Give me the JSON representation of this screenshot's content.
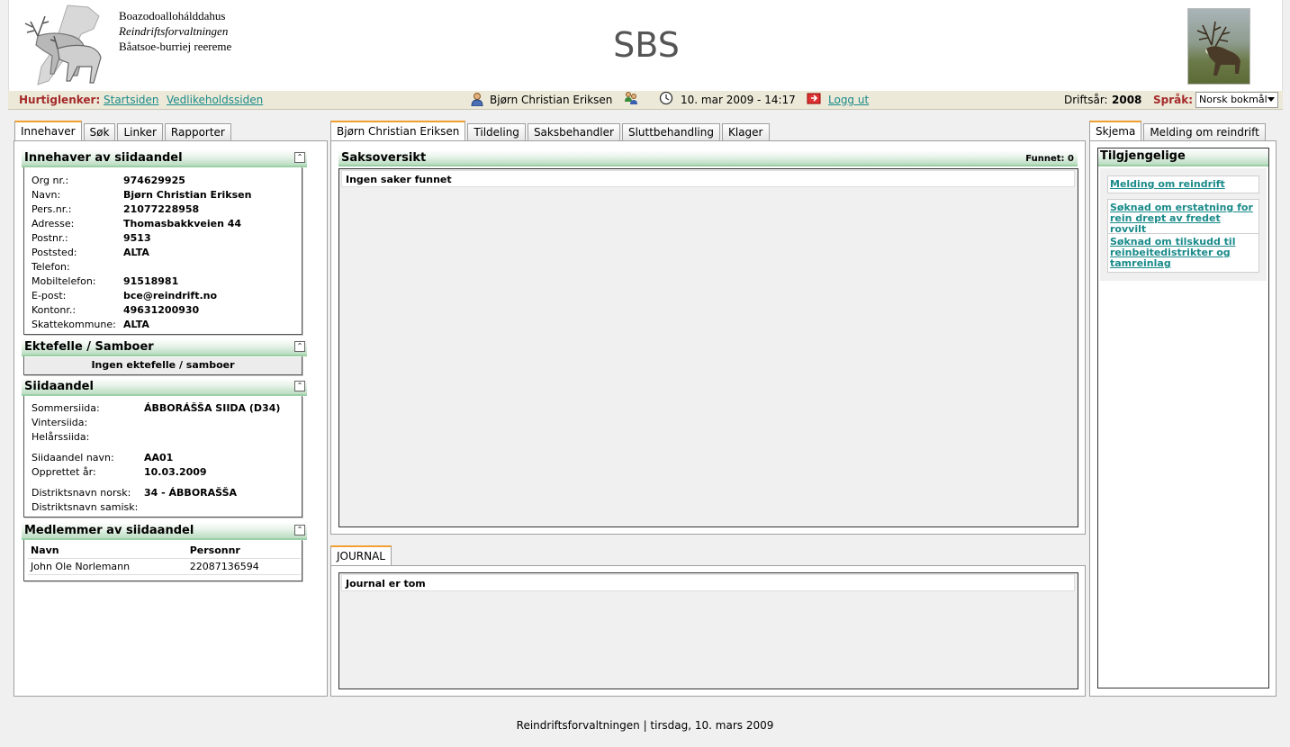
{
  "header": {
    "org_lines": [
      "Boazodoallohálddahus",
      "Reindriftsforvaltningen",
      "Båatsoe-burriej reereme"
    ],
    "app_title": "SBS"
  },
  "quickbar": {
    "label": "Hurtiglenker:",
    "links": [
      "Startsiden",
      "Vedlikeholdssiden"
    ],
    "user_name": "Bjørn Christian Eriksen",
    "datetime": "10. mar 2009 - 14:17",
    "logout": "Logg ut",
    "driftsar_label": "Driftsår:",
    "driftsar_value": "2008",
    "language_label": "Språk:",
    "language_value": "Norsk bokmål"
  },
  "left_tabs": [
    "Innehaver",
    "Søk",
    "Linker",
    "Rapporter"
  ],
  "owner": {
    "title": "Innehaver av siidaandel",
    "fields": [
      {
        "label": "Org nr.:",
        "value": "974629925"
      },
      {
        "label": "Navn:",
        "value": "Bjørn Christian Eriksen"
      },
      {
        "label": "Pers.nr.:",
        "value": "21077228958"
      },
      {
        "label": "Adresse:",
        "value": "Thomasbakkveien 44"
      },
      {
        "label": "Postnr.:",
        "value": "9513"
      },
      {
        "label": "Poststed:",
        "value": "ALTA"
      },
      {
        "label": "Telefon:",
        "value": ""
      },
      {
        "label": "Mobiltelefon:",
        "value": "91518981"
      },
      {
        "label": "E-post:",
        "value": "bce@reindrift.no"
      },
      {
        "label": "Kontonr.:",
        "value": "49631200930"
      },
      {
        "label": "Skattekommune:",
        "value": "ALTA"
      }
    ]
  },
  "spouse": {
    "title": "Ektefelle / Samboer",
    "empty": "Ingen ektefelle / samboer"
  },
  "siida": {
    "title": "Siidaandel",
    "fields": [
      {
        "label": "Sommersiida:",
        "value": "ÁBBORÁŠŠA SIIDA (D34)"
      },
      {
        "label": "Vintersiida:",
        "value": ""
      },
      {
        "label": "Helårssiida:",
        "value": ""
      },
      {
        "label": "Siidaandel navn:",
        "value": "AA01"
      },
      {
        "label": "Opprettet år:",
        "value": "10.03.2009"
      },
      {
        "label": "Distriktsnavn norsk:",
        "value": "34 - ÁBBORAŠŠA"
      },
      {
        "label": "Distriktsnavn samisk:",
        "value": ""
      }
    ]
  },
  "members": {
    "title": "Medlemmer av siidaandel",
    "columns": [
      "Navn",
      "Personnr"
    ],
    "rows": [
      [
        "John Ole Norlemann",
        "22087136594"
      ]
    ]
  },
  "center_tabs": [
    "Bjørn Christian Eriksen",
    "Tildeling",
    "Saksbehandler",
    "Sluttbehandling",
    "Klager"
  ],
  "cases": {
    "title": "Saksoversikt",
    "found_label": "Funnet: 0",
    "empty": "Ingen saker funnet"
  },
  "journal": {
    "tab": "JOURNAL",
    "empty": "Journal er tom"
  },
  "right_tabs": [
    "Skjema",
    "Melding om reindrift"
  ],
  "forms": {
    "title": "Tilgjengelige",
    "links": [
      "Melding om reindrift",
      "Søknad om erstatning for rein drept av fredet rovvilt",
      "Søknad om tilskudd til reinbeitedistrikter og tamreinlag"
    ]
  },
  "footer": "Reindriftsforvaltningen | tirsdag, 10. mars 2009",
  "colors": {
    "accent_tab": "#f0a030",
    "section_green": "#b9dcc0",
    "link": "#1a8a8a",
    "label_red": "#a52a2a"
  }
}
